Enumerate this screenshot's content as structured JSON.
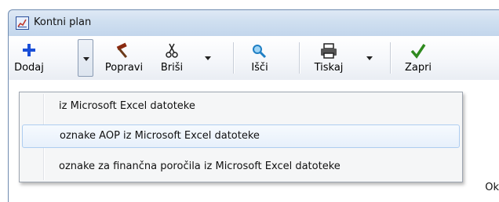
{
  "window": {
    "title": "Kontni plan"
  },
  "toolbar": {
    "add_label": "Dodaj",
    "edit_label": "Popravi",
    "delete_label": "Briši",
    "search_label": "Išči",
    "print_label": "Tiskaj",
    "close_label": "Zapri"
  },
  "menu": {
    "items": [
      {
        "label": "iz Microsoft Excel datoteke"
      },
      {
        "label": "oznake AOP iz Microsoft Excel datoteke"
      },
      {
        "label": "oznake za finančna poročila iz Microsoft Excel datoteke"
      }
    ],
    "highlighted_index": 1
  },
  "content": {
    "partial_label": "Ok"
  },
  "colors": {
    "add_icon": "#1a4fd8",
    "edit_icon": "#8a2a10",
    "close_icon": "#2f8a1f",
    "search_icon": "#1f7fc4",
    "menu_highlight_border": "#aecdf0"
  }
}
